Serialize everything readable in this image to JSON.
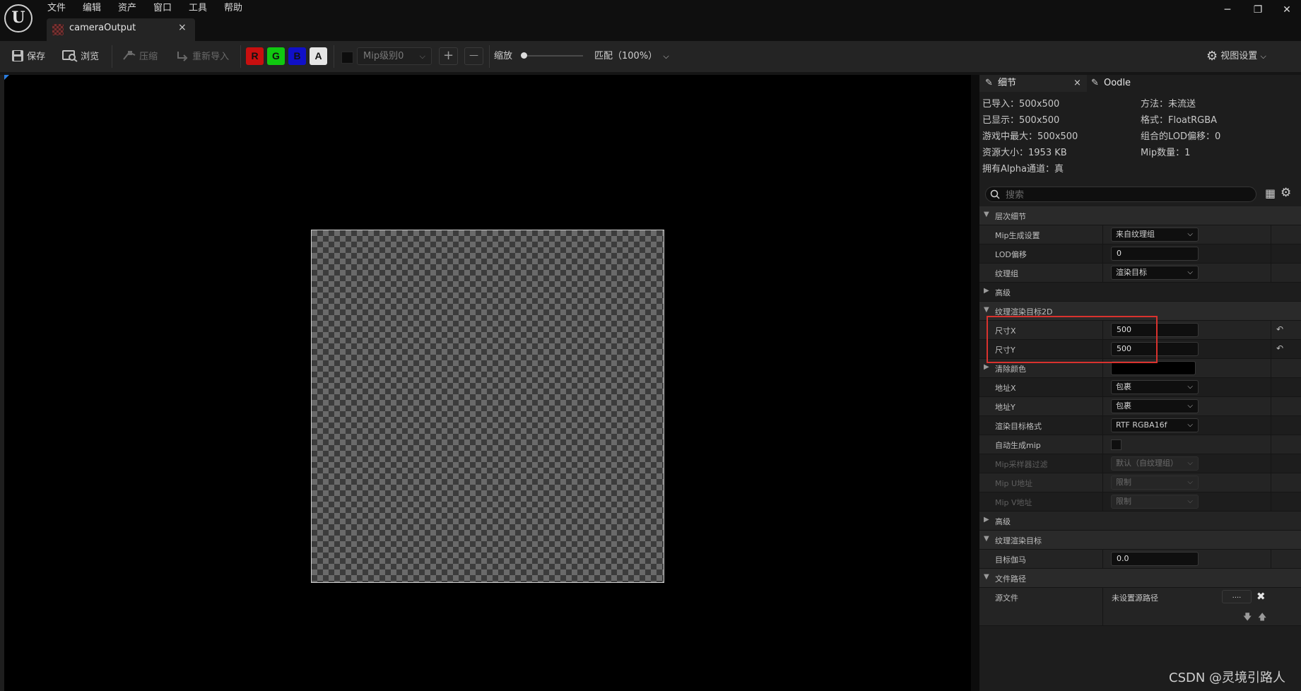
{
  "menu": [
    "文件",
    "编辑",
    "资产",
    "窗口",
    "工具",
    "帮助"
  ],
  "tab": {
    "title": "cameraOutput",
    "close": "×"
  },
  "window_controls": {
    "minimize": "─",
    "restore": "❐",
    "close": "✕"
  },
  "toolbar": {
    "save": "保存",
    "browse": "浏览",
    "compress": "压缩",
    "reimport": "重新导入",
    "channels": [
      {
        "label": "R",
        "color": "#d01010"
      },
      {
        "label": "G",
        "color": "#10d010"
      },
      {
        "label": "B",
        "color": "#1010d0"
      },
      {
        "label": "A",
        "color": "#e6e6e6"
      }
    ],
    "mip_level": "Mip级别0",
    "plus": "+",
    "minus": "—",
    "zoom_label": "缩放",
    "fit": "匹配（100%）",
    "view_settings": "视图设置"
  },
  "panel": {
    "tabs": [
      "细节",
      "Oodle"
    ],
    "tab_close": "×",
    "info_left": [
      "已导入：500x500",
      "已显示：500x500",
      "游戏中最大：500x500",
      "资源大小：1953 KB",
      "拥有Alpha通道：真"
    ],
    "info_right": [
      "方法：未流送",
      "格式：FloatRGBA",
      "组合的LOD偏移：0",
      "Mip数量：1"
    ],
    "search_placeholder": "搜索",
    "rows": [
      {
        "label": "层次细节"
      },
      {
        "label": "Mip生成设置",
        "value": "来自纹理组"
      },
      {
        "label": "LOD偏移",
        "value": "0"
      },
      {
        "label": "纹理组",
        "value": "渲染目标"
      },
      {
        "label": "高级"
      },
      {
        "label": "纹理渲染目标2D"
      },
      {
        "label": "尺寸X",
        "value": "500"
      },
      {
        "label": "尺寸Y",
        "value": "500"
      },
      {
        "label": "清除颜色"
      },
      {
        "label": "地址X",
        "value": "包裹"
      },
      {
        "label": "地址Y",
        "value": "包裹"
      },
      {
        "label": "渲染目标格式",
        "value": "RTF RGBA16f"
      },
      {
        "label": "自动生成mip"
      },
      {
        "label": "Mip采样器过滤",
        "value": "默认（自纹理组）"
      },
      {
        "label": "Mip U地址",
        "value": "限制"
      },
      {
        "label": "Mip V地址",
        "value": "限制"
      },
      {
        "label": "高级"
      },
      {
        "label": "纹理渲染目标"
      },
      {
        "label": "目标伽马",
        "value": "0.0"
      },
      {
        "label": "文件路径"
      },
      {
        "label": "源文件",
        "value": "未设置源路径",
        "browse": "...."
      }
    ]
  },
  "watermark": "CSDN @灵境引路人",
  "colors": {
    "accent": "#2a7de1",
    "highlight": "#d9322e"
  }
}
